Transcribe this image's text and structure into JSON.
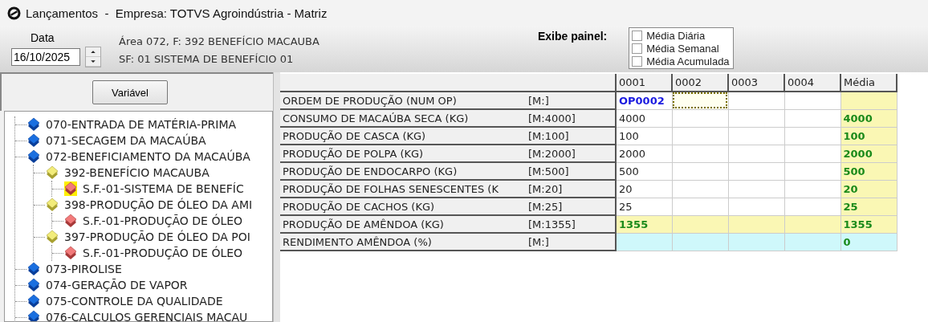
{
  "window": {
    "title": "Lançamentos  -  Empresa: TOTVS Agroindústria - Matriz"
  },
  "header": {
    "date_label": "Data",
    "date_value": "16/10/2025",
    "info_lines": [
      "Área 072, F: 392 BENEFÍCIO MACAUBA",
      "SF: 01 SISTEMA DE BENEFÍCIO 01"
    ],
    "panel_label": "Exibe painel:",
    "panel_options": [
      {
        "label": "Média Diária",
        "checked": false
      },
      {
        "label": "Média Semanal",
        "checked": false
      },
      {
        "label": "Média Acumulada",
        "checked": false
      }
    ]
  },
  "sidebar": {
    "button": "Variável",
    "tree": [
      {
        "label": "070-ENTRADA DE MATÉRIA-PRIMA",
        "kind": "area",
        "selected": false
      },
      {
        "label": "071-SECAGEM DA MACAÚBA",
        "kind": "area",
        "selected": false
      },
      {
        "label": "072-BENEFICIAMENTO DA MACAÚBA",
        "kind": "area",
        "selected": false,
        "children": [
          {
            "label": "392-BENEFÍCIO MACAUBA",
            "kind": "function",
            "selected": false,
            "children": [
              {
                "label": "S.F.-01-SISTEMA DE BENEFÍC",
                "kind": "subfunction",
                "selected": true
              }
            ]
          },
          {
            "label": "398-PRODUÇÃO DE ÓLEO DA AMI",
            "kind": "function",
            "selected": false,
            "children": [
              {
                "label": "S.F.-01-PRODUÇÃO DE ÓLEO",
                "kind": "subfunction",
                "selected": false
              }
            ]
          },
          {
            "label": "397-PRODUÇÃO DE ÓLEO DA POI",
            "kind": "function",
            "selected": false,
            "children": [
              {
                "label": "S.F.-01-PRODUÇÃO DE ÓLEO",
                "kind": "subfunction",
                "selected": false
              }
            ]
          }
        ]
      },
      {
        "label": "073-PIROLISE",
        "kind": "area",
        "selected": false
      },
      {
        "label": "074-GERAÇÃO DE VAPOR",
        "kind": "area",
        "selected": false
      },
      {
        "label": "075-CONTROLE DA QUALIDADE",
        "kind": "area",
        "selected": false
      },
      {
        "label": "076-CALCULOS GERENCIAIS MACAU",
        "kind": "area",
        "selected": false
      }
    ]
  },
  "table": {
    "columns": [
      "0001",
      "0002",
      "0003",
      "0004",
      "Média"
    ],
    "rows": [
      {
        "label": "ORDEM DE PRODUÇÃO (NUM OP)",
        "limit": "[M:]",
        "kind": "order",
        "cells": [
          {
            "value": "OP0002",
            "selected": false
          },
          {
            "selected": true
          },
          {
            "selected": false
          },
          {
            "selected": false
          },
          {
            "selected": false
          }
        ]
      },
      {
        "label": "CONSUMO DE MACAÚBA SECA (KG)",
        "limit": "[M:4000]",
        "kind": "input",
        "cells": [
          {
            "value": "4000",
            "selected": false
          },
          {
            "selected": false
          },
          {
            "selected": false
          },
          {
            "selected": false
          },
          {
            "value": "4000",
            "selected": false
          }
        ]
      },
      {
        "label": "PRODUÇÃO DE CASCA (KG)",
        "limit": "[M:100]",
        "kind": "input",
        "cells": [
          {
            "value": "100",
            "selected": false
          },
          {
            "selected": false
          },
          {
            "selected": false
          },
          {
            "selected": false
          },
          {
            "value": "100",
            "selected": false
          }
        ]
      },
      {
        "label": "PRODUÇÃO DE POLPA (KG)",
        "limit": "[M:2000]",
        "kind": "input",
        "cells": [
          {
            "value": "2000",
            "selected": false
          },
          {
            "selected": false
          },
          {
            "selected": false
          },
          {
            "selected": false
          },
          {
            "value": "2000",
            "selected": false
          }
        ]
      },
      {
        "label": "PRODUÇÃO DE ENDOCARPO (KG)",
        "limit": "[M:500]",
        "kind": "input",
        "cells": [
          {
            "value": "500",
            "selected": false
          },
          {
            "selected": false
          },
          {
            "selected": false
          },
          {
            "selected": false
          },
          {
            "value": "500",
            "selected": false
          }
        ]
      },
      {
        "label": "PRODUÇÃO DE FOLHAS SENESCENTES (K",
        "limit": "[M:20]",
        "kind": "input",
        "cells": [
          {
            "value": "20",
            "selected": false
          },
          {
            "selected": false
          },
          {
            "selected": false
          },
          {
            "selected": false
          },
          {
            "value": "20",
            "selected": false
          }
        ]
      },
      {
        "label": "PRODUÇÃO DE CACHOS (KG)",
        "limit": "[M:25]",
        "kind": "input",
        "cells": [
          {
            "value": "25",
            "selected": false
          },
          {
            "selected": false
          },
          {
            "selected": false
          },
          {
            "selected": false
          },
          {
            "value": "25",
            "selected": false
          }
        ]
      },
      {
        "label": "PRODUÇÃO DE AMÊNDOA (KG)",
        "limit": "[M:1355]",
        "kind": "computed",
        "cells": [
          {
            "value": "1355",
            "selected": false
          },
          {
            "selected": false
          },
          {
            "selected": false
          },
          {
            "selected": false
          },
          {
            "value": "1355",
            "selected": false
          }
        ]
      },
      {
        "label": "RENDIMENTO AMÊNDOA (%)",
        "limit": "[M:]",
        "kind": "ratio",
        "cells": [
          {
            "selected": false
          },
          {
            "selected": false
          },
          {
            "selected": false
          },
          {
            "selected": false
          },
          {
            "value": "0",
            "selected": false
          }
        ]
      }
    ]
  }
}
